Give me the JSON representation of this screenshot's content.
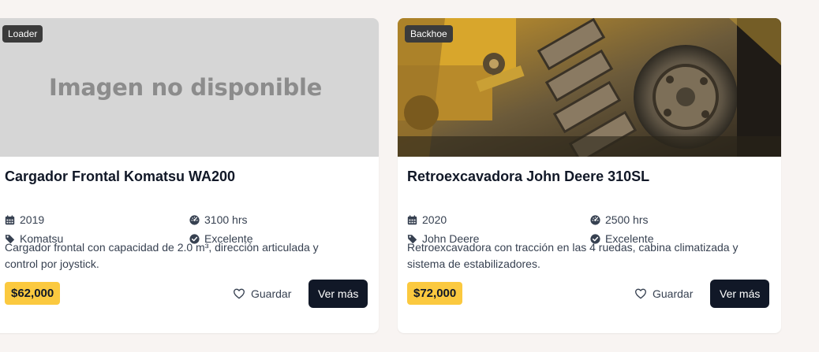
{
  "listings": [
    {
      "badge": "Loader",
      "image_placeholder": "Imagen no disponible",
      "title": "Cargador Frontal Komatsu WA200",
      "year": "2019",
      "hours": "3100 hrs",
      "brand": "Komatsu",
      "condition": "Excelente",
      "description": "Cargador frontal con capacidad de 2.0 m³, dirección articulada y control por joystick.",
      "price": "$62,000",
      "save_label": "Guardar",
      "more_label": "Ver más"
    },
    {
      "badge": "Backhoe",
      "title": "Retroexcavadora John Deere 310SL",
      "year": "2020",
      "hours": "2500 hrs",
      "brand": "John Deere",
      "condition": "Excelente",
      "description": "Retroexcavadora con tracción en las 4 ruedas, cabina climatizada y sistema de estabilizadores.",
      "price": "$72,000",
      "save_label": "Guardar",
      "more_label": "Ver más"
    }
  ],
  "icons": {
    "year": "calendar-icon",
    "hours": "gauge-icon",
    "brand": "tag-icon",
    "condition": "check-circle-icon",
    "save": "heart-icon"
  },
  "colors": {
    "price_badge": "#fbc93f",
    "primary_button": "#111827",
    "category_badge": "#3b3b3b",
    "placeholder_bg": "#d6d6d6"
  }
}
